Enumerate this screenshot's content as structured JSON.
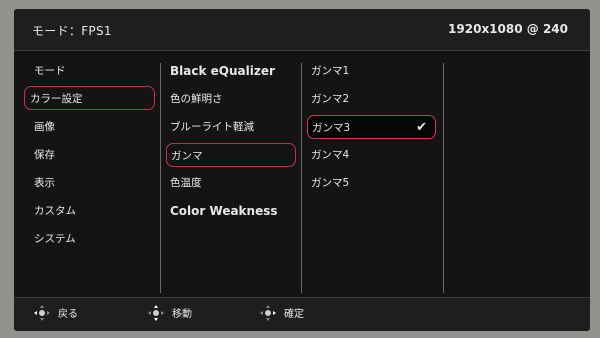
{
  "header": {
    "title": "モード：FPS1",
    "resolution": "1920x1080 @ 240"
  },
  "menu1": {
    "items": [
      "モード",
      "カラー設定",
      "画像",
      "保存",
      "表示",
      "カスタム",
      "システム"
    ],
    "selected_index": 1
  },
  "menu2": {
    "items": [
      "Black eQualizer",
      "色の鮮明さ",
      "ブルーライト軽減",
      "ガンマ",
      "色温度",
      "Color Weakness"
    ],
    "selected_index": 3
  },
  "menu3": {
    "items": [
      "ガンマ1",
      "ガンマ2",
      "ガンマ3",
      "ガンマ4",
      "ガンマ5"
    ],
    "active_index": 2,
    "checkmark": "✔"
  },
  "footer": {
    "back": "戻る",
    "move": "移動",
    "confirm": "確定"
  },
  "colors": {
    "accent": "#c2334a",
    "background": "#141414",
    "bar": "#1e1e1e"
  }
}
